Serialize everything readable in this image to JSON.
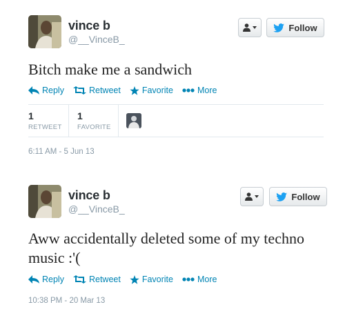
{
  "tweets": [
    {
      "name": "vince b",
      "handle": "@__VinceB_",
      "follow_label": "Follow",
      "text": "Bitch make me a sandwich",
      "actions": {
        "reply": "Reply",
        "retweet": "Retweet",
        "favorite": "Favorite",
        "more": "More"
      },
      "stats": {
        "retweets": {
          "count": "1",
          "label": "RETWEET"
        },
        "favorites": {
          "count": "1",
          "label": "FAVORITE"
        }
      },
      "timestamp": "6:11 AM - 5 Jun 13"
    },
    {
      "name": "vince b",
      "handle": "@__VinceB_",
      "follow_label": "Follow",
      "text": "Aww accidentally deleted some of my techno music :'(",
      "actions": {
        "reply": "Reply",
        "retweet": "Retweet",
        "favorite": "Favorite",
        "more": "More"
      },
      "timestamp": "10:38 PM - 20 Mar 13"
    }
  ],
  "colors": {
    "link": "#0084b4",
    "twitter_blue": "#1da1f2",
    "muted": "#8899a6"
  },
  "icons": [
    "user-dropdown-icon",
    "twitter-bird-icon",
    "reply-arrow-icon",
    "retweet-icon",
    "favorite-star-icon",
    "more-dots-icon"
  ]
}
